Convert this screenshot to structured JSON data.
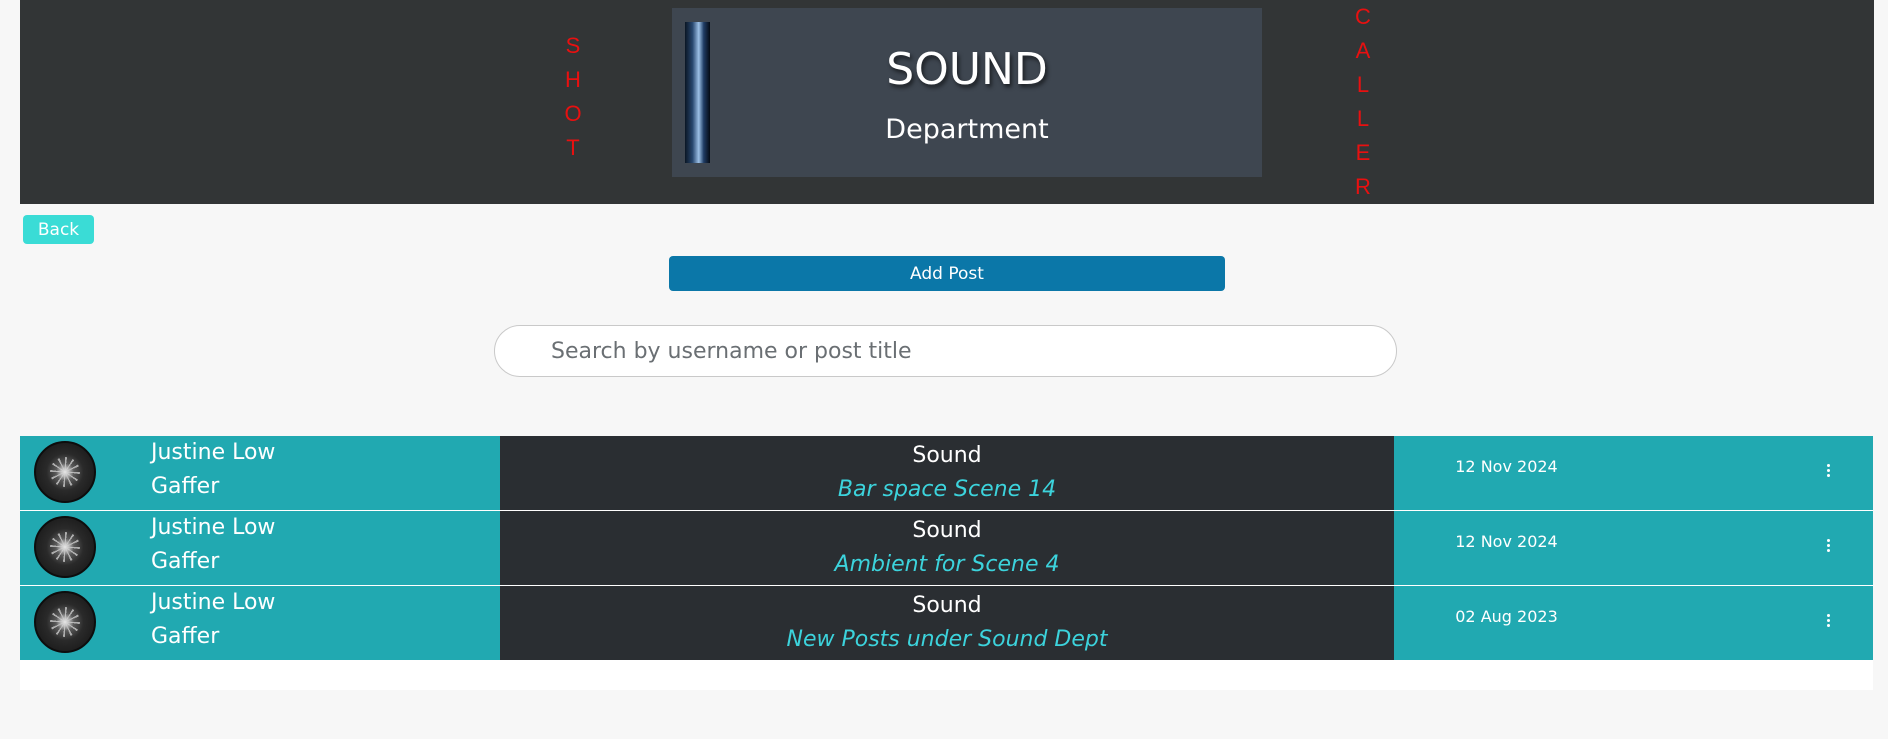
{
  "header": {
    "left_vertical_letters": [
      "S",
      "H",
      "O",
      "T"
    ],
    "right_vertical_letters": [
      "C",
      "A",
      "L",
      "L",
      "E",
      "R"
    ],
    "banner_title": "SOUND",
    "banner_subtitle": "Department"
  },
  "actions": {
    "back_label": "Back",
    "add_post_label": "Add Post"
  },
  "search": {
    "placeholder": "Search by username or post title",
    "value": ""
  },
  "posts": [
    {
      "user_name": "Justine Low",
      "user_role": "Gaffer",
      "department": "Sound",
      "title": "Bar space Scene 14",
      "date": "12 Nov 2024"
    },
    {
      "user_name": "Justine Low",
      "user_role": "Gaffer",
      "department": "Sound",
      "title": "Ambient for Scene 4",
      "date": "12 Nov 2024"
    },
    {
      "user_name": "Justine Low",
      "user_role": "Gaffer",
      "department": "Sound",
      "title": "New Posts under Sound Dept",
      "date": "02 Aug 2023"
    }
  ],
  "colors": {
    "header_bg": "#323536",
    "banner_bg": "#3e4650",
    "accent_red": "#e81010",
    "back_button": "#3adcd6",
    "add_button": "#0b77a8",
    "row_teal": "#21a9b1",
    "row_dark": "#2a2e32",
    "title_cyan": "#3cd3dc"
  },
  "icons": {
    "kebab": "more-vertical-icon",
    "avatar": "user-avatar"
  }
}
